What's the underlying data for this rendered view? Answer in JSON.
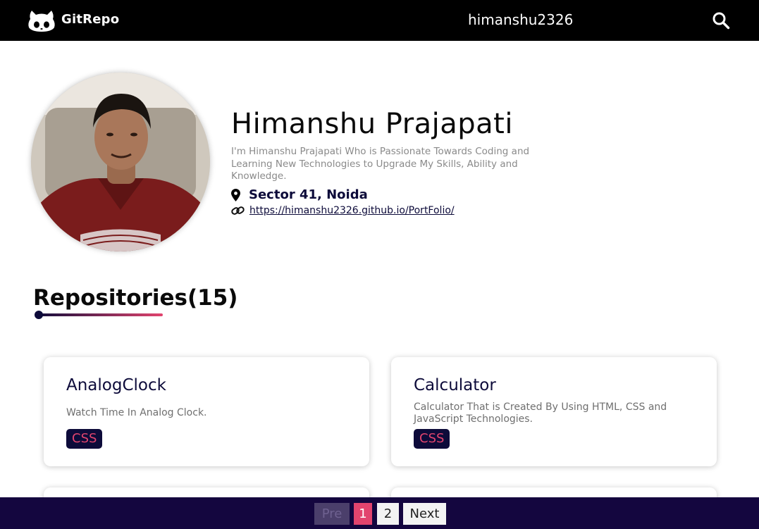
{
  "nav": {
    "brand": "GitRepo",
    "username": "himanshu2326",
    "logo_icon": "github-octocat-icon",
    "search_icon": "search-icon"
  },
  "profile": {
    "name": "Himanshu Prajapati",
    "bio": "I'm Himanshu Prajapati Who is Passionate Towards Coding and Learning New Technologies to Upgrade My Skills, Ability and Knowledge.",
    "location": "Sector 41, Noida",
    "website": "https://himanshu2326.github.io/PortFolio/"
  },
  "repositories": {
    "heading": "Repositories(15)",
    "items": [
      {
        "name": "AnalogClock",
        "description": "Watch Time In Analog Clock.",
        "language": "CSS"
      },
      {
        "name": "Calculator",
        "description": "Calculator That is Created By Using HTML, CSS and JavaScript Technologies.",
        "language": "CSS"
      }
    ]
  },
  "pagination": {
    "prev": "Pre",
    "pages": [
      "1",
      "2"
    ],
    "current": "1",
    "next": "Next"
  },
  "colors": {
    "topbar": "#000000",
    "accent_pink": "#e2446e",
    "navy": "#0d0b3a",
    "pager_bg": "#14063f"
  }
}
